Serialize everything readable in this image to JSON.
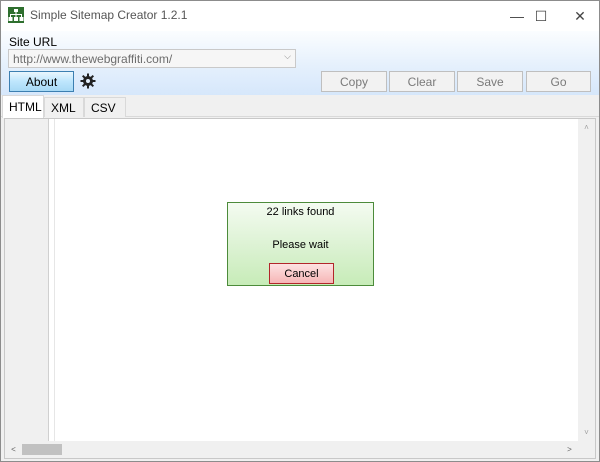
{
  "window": {
    "title": "Simple Sitemap Creator 1.2.1",
    "icon": "sitemap-app-icon",
    "controls": {
      "minimize": "—",
      "maximize": "☐",
      "close": "✕"
    }
  },
  "toolbar": {
    "site_url_label": "Site URL",
    "site_url_value": "http://www.thewebgraffiti.com/",
    "about_label": "About",
    "settings_icon": "gear-icon",
    "copy_label": "Copy",
    "clear_label": "Clear",
    "save_label": "Save",
    "go_label": "Go"
  },
  "tabs": [
    {
      "label": "HTML",
      "active": true
    },
    {
      "label": "XML",
      "active": false
    },
    {
      "label": "CSV",
      "active": false
    }
  ],
  "progress_dialog": {
    "links_found": "22 links found",
    "status": "Please wait",
    "cancel_label": "Cancel"
  },
  "scrollbars": {
    "up": "˄",
    "down": "˅",
    "left": "<",
    "right": ">"
  },
  "colors": {
    "accent_about": "#bee6fd",
    "dialog_bg": "#d9f1cf",
    "dialog_border": "#4c8b3a",
    "cancel_bg": "#f6b6b6",
    "cancel_border": "#b2262a"
  }
}
